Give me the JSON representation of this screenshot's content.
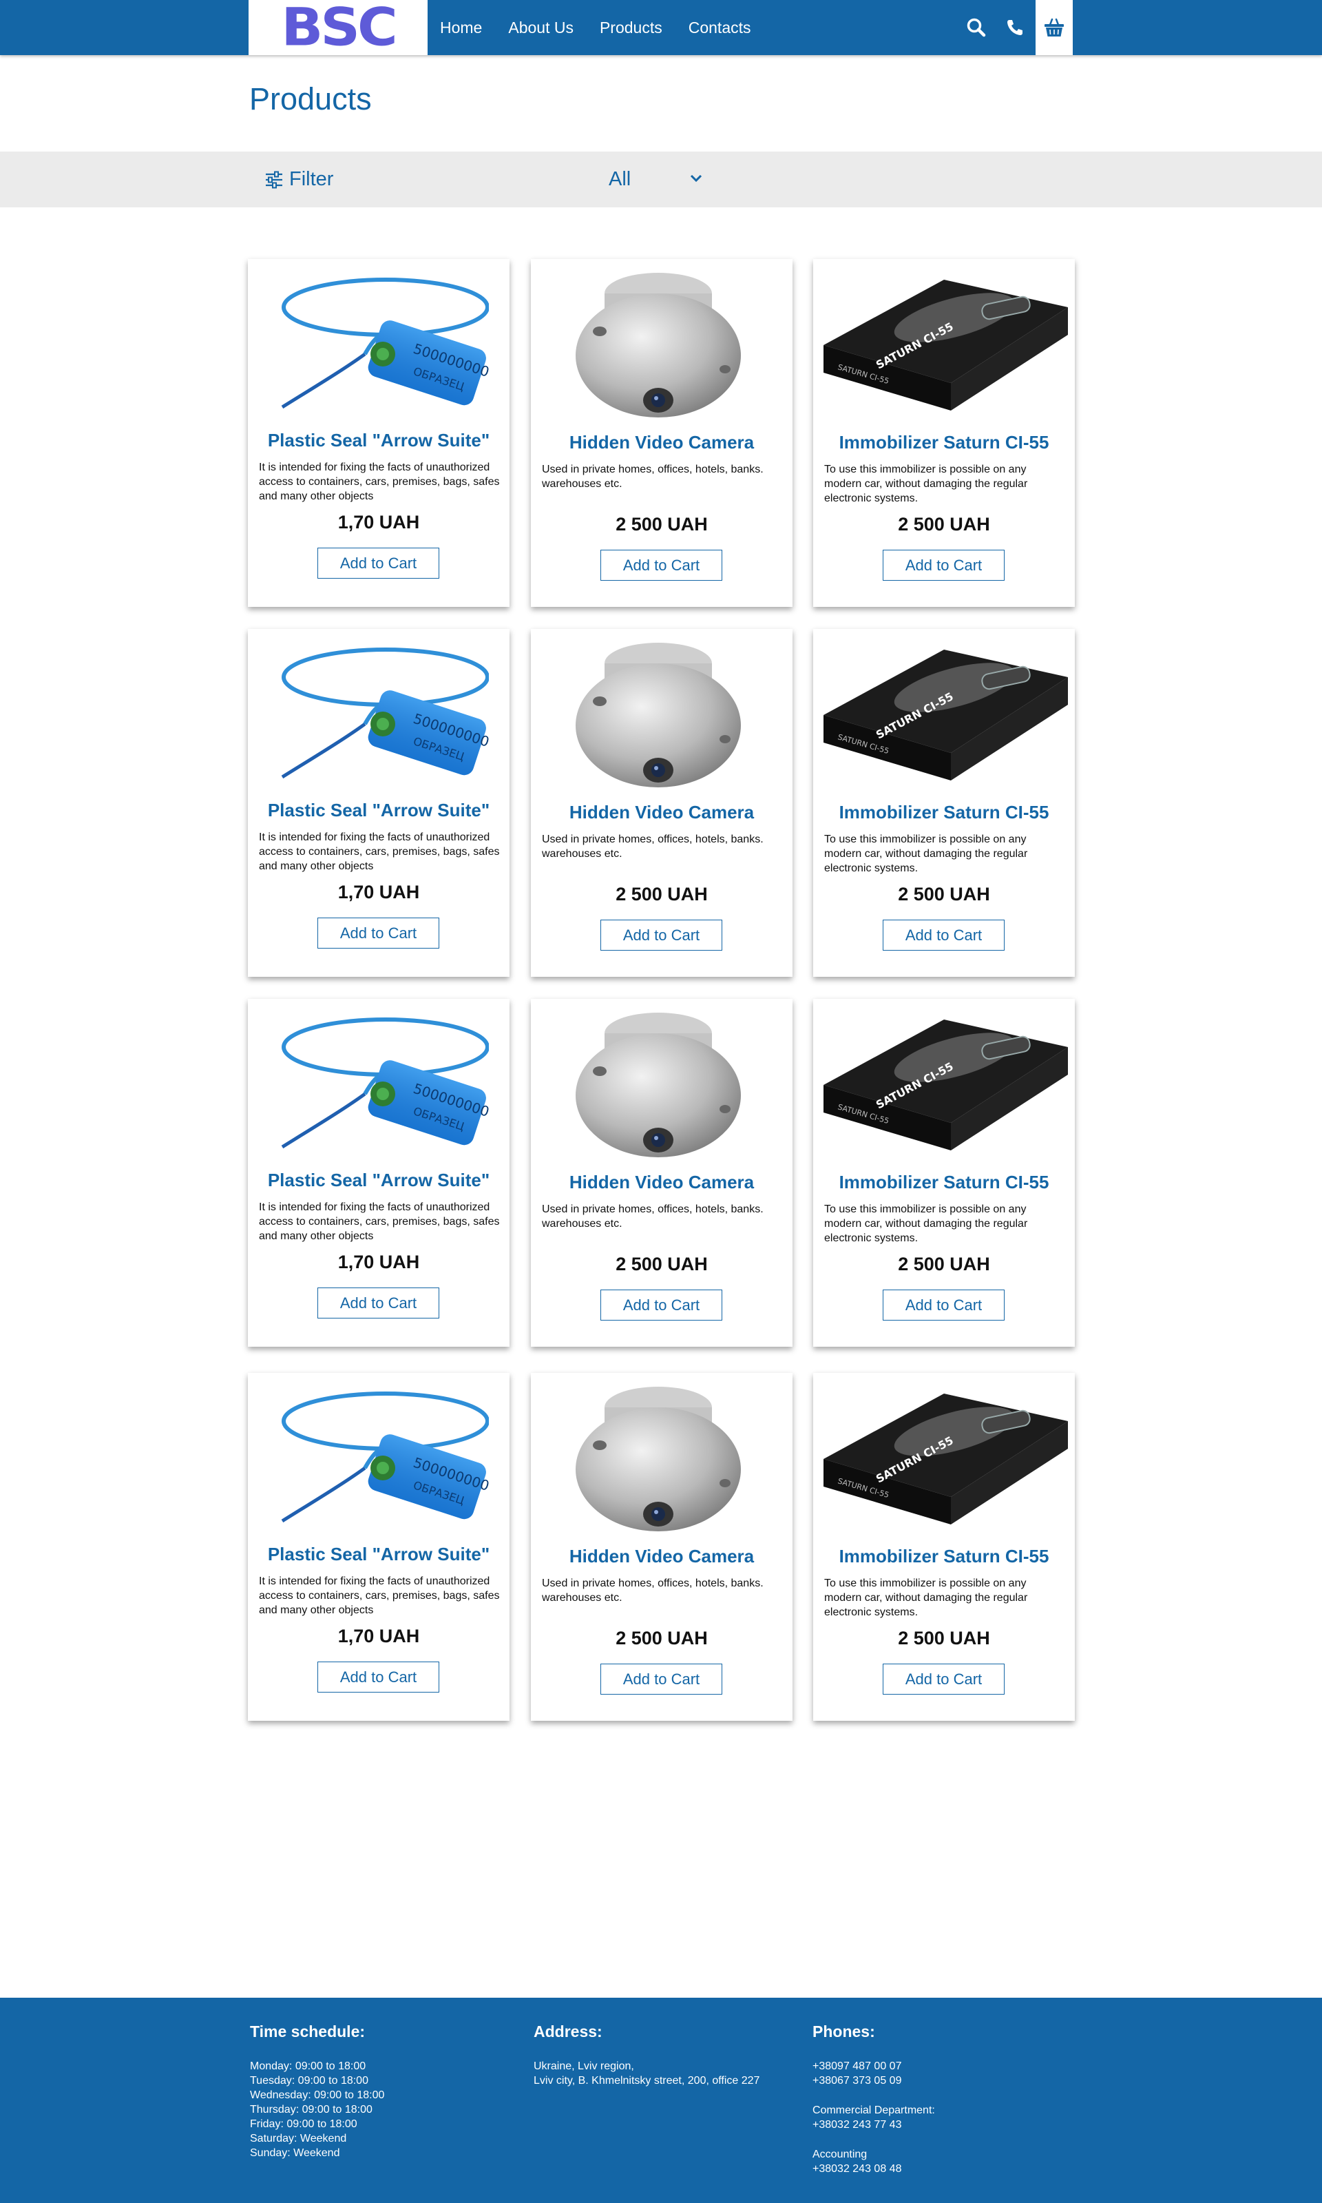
{
  "header": {
    "logo": "BSC",
    "nav": [
      "Home",
      "About Us",
      "Products",
      "Contacts"
    ],
    "icons": [
      "search-icon",
      "phone-icon",
      "cart-icon"
    ]
  },
  "page_title": "Products",
  "filter": {
    "label": "Filter",
    "selected": "All"
  },
  "products": [
    {
      "title": "Plastic Seal \"Arrow Suite\"",
      "desc": "It is intended for fixing the facts of unauthorized access to containers, cars, premises, bags, safes and many other objects",
      "price": "1,70 UAH",
      "button": "Add to Cart",
      "image": "blue-plastic-seal"
    },
    {
      "title": "Hidden Video Camera",
      "desc": "Used in private homes, offices, hotels, banks. warehouses etc.",
      "price": "2 500 UAH",
      "button": "Add to Cart",
      "image": "dome-camera"
    },
    {
      "title": "Immobilizer Saturn CI-55",
      "desc": "To use this immobilizer is possible on any modern car, without damaging the regular electronic systems.",
      "price": "2 500 UAH",
      "button": "Add to Cart",
      "image": "immobilizer-box"
    },
    {
      "title": "Plastic Seal \"Arrow Suite\"",
      "desc": "It is intended for fixing the facts of unauthorized access to containers, cars, premises, bags, safes and many other objects",
      "price": "1,70 UAH",
      "button": "Add to Cart",
      "image": "blue-plastic-seal"
    },
    {
      "title": "Hidden Video Camera",
      "desc": "Used in private homes, offices, hotels, banks. warehouses etc.",
      "price": "2 500 UAH",
      "button": "Add to Cart",
      "image": "dome-camera"
    },
    {
      "title": "Immobilizer Saturn CI-55",
      "desc": "To use this immobilizer is possible on any modern car, without damaging the regular electronic systems.",
      "price": "2 500 UAH",
      "button": "Add to Cart",
      "image": "immobilizer-box"
    },
    {
      "title": "Plastic Seal \"Arrow Suite\"",
      "desc": "It is intended for fixing the facts of unauthorized access to containers, cars, premises, bags, safes and many other objects",
      "price": "1,70 UAH",
      "button": "Add to Cart",
      "image": "blue-plastic-seal"
    },
    {
      "title": "Hidden Video Camera",
      "desc": "Used in private homes, offices, hotels, banks. warehouses etc.",
      "price": "2 500 UAH",
      "button": "Add to Cart",
      "image": "dome-camera"
    },
    {
      "title": "Immobilizer Saturn CI-55",
      "desc": "To use this immobilizer is possible on any modern car, without damaging the regular electronic systems.",
      "price": "2 500 UAH",
      "button": "Add to Cart",
      "image": "immobilizer-box"
    },
    {
      "title": "Plastic Seal \"Arrow Suite\"",
      "desc": "It is intended for fixing the facts of unauthorized access to containers, cars, premises, bags, safes and many other objects",
      "price": "1,70 UAH",
      "button": "Add to Cart",
      "image": "blue-plastic-seal"
    },
    {
      "title": "Hidden Video Camera",
      "desc": "Used in private homes, offices, hotels, banks. warehouses etc.",
      "price": "2 500 UAH",
      "button": "Add to Cart",
      "image": "dome-camera"
    },
    {
      "title": "Immobilizer Saturn CI-55",
      "desc": "To use this immobilizer is possible on any modern car, without damaging the regular electronic systems.",
      "price": "2 500 UAH",
      "button": "Add to Cart",
      "image": "immobilizer-box"
    }
  ],
  "footer": {
    "schedule": {
      "title": "Time schedule:",
      "lines": [
        "Monday: 09:00 to 18:00",
        "Tuesday: 09:00 to 18:00",
        "Wednesday: 09:00 to 18:00",
        "Thursday: 09:00 to 18:00",
        "Friday: 09:00 to 18:00",
        "Saturday: Weekend",
        "Sunday: Weekend"
      ]
    },
    "address": {
      "title": "Address:",
      "lines": [
        "Ukraine, Lviv region,",
        "Lviv city, B. Khmelnitsky  street, 200, office 227"
      ]
    },
    "phones": {
      "title": "Phones:",
      "main": [
        "+38097 487 00 07",
        "+38067 373 05 09"
      ],
      "commercial_label": "Commercial Department:",
      "commercial": "+38032 243 77 43",
      "accounting_label": "Accounting",
      "accounting": "+38032 243 08 48"
    }
  },
  "colors": {
    "brand": "#1466a6",
    "logo": "#5e5bd8",
    "filter_bar": "#ebebeb"
  }
}
